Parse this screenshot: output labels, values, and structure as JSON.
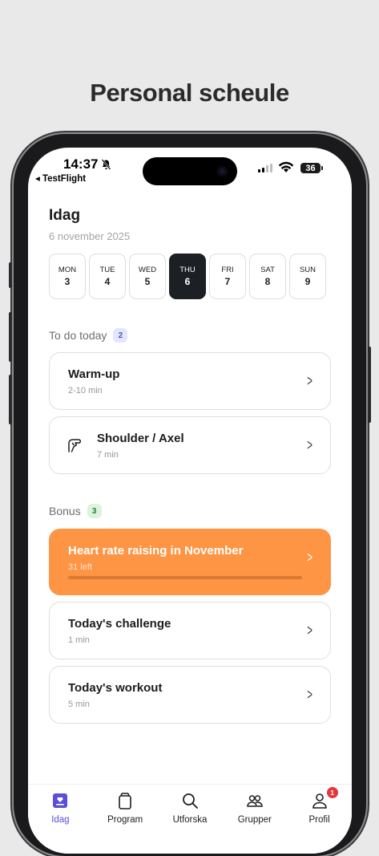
{
  "headline": "Personal scheule",
  "status_bar": {
    "time": "14:37",
    "back_app": "◂ TestFlight",
    "battery": "36"
  },
  "page": {
    "title": "Idag",
    "date": "6 november 2025"
  },
  "week": [
    {
      "day": "MON",
      "num": "3"
    },
    {
      "day": "TUE",
      "num": "4"
    },
    {
      "day": "WED",
      "num": "5"
    },
    {
      "day": "THU",
      "num": "6",
      "active": true
    },
    {
      "day": "FRI",
      "num": "7"
    },
    {
      "day": "SAT",
      "num": "8"
    },
    {
      "day": "SUN",
      "num": "9"
    }
  ],
  "todo": {
    "label": "To do today",
    "count": "2",
    "items": [
      {
        "title": "Warm-up",
        "sub": "2-10 min",
        "icon": "none"
      },
      {
        "title": "Shoulder / Axel",
        "sub": "7 min",
        "icon": "shoulder-icon"
      }
    ]
  },
  "bonus": {
    "label": "Bonus",
    "count": "3",
    "items": [
      {
        "title": "Heart rate raising in November",
        "sub": "31 left",
        "progress": 0.0,
        "highlight": true
      },
      {
        "title": "Today's challenge",
        "sub": "1 min"
      },
      {
        "title": "Today's workout",
        "sub": "5 min"
      }
    ]
  },
  "tabs": [
    {
      "label": "Idag",
      "icon": "today-icon",
      "active": true
    },
    {
      "label": "Program",
      "icon": "program-icon"
    },
    {
      "label": "Utforska",
      "icon": "search-icon"
    },
    {
      "label": "Grupper",
      "icon": "groups-icon"
    },
    {
      "label": "Profil",
      "icon": "profile-icon",
      "badge": "1"
    }
  ],
  "colors": {
    "accent": "#5a4fd6",
    "bonus_card": "#fd9545",
    "active_day": "#1c1f24"
  }
}
